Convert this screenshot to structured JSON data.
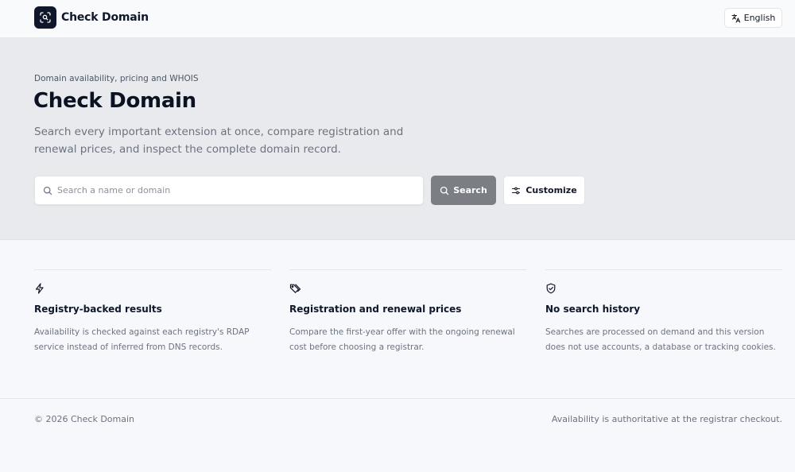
{
  "header": {
    "app_name": "Check Domain",
    "language_label": "English",
    "logo_icon": "magnify-scan-icon",
    "language_icon": "translate-icon"
  },
  "hero": {
    "eyebrow": "Domain availability, pricing and WHOIS",
    "title": "Check Domain",
    "description": "Search every important extension at once, compare registration and renewal prices, and inspect the complete domain record.",
    "search_placeholder": "Search a name or domain",
    "search_value": "",
    "search_button_label": "Search",
    "customize_button_label": "Customize",
    "search_button_color": "#7c7e86"
  },
  "features": [
    {
      "icon": "lightning-icon",
      "title": "Registry-backed results",
      "description": "Availability is checked against each registry's RDAP service instead of inferred from DNS records."
    },
    {
      "icon": "price-tags-icon",
      "title": "Registration and renewal prices",
      "description": "Compare the first-year offer with the ongoing renewal cost before choosing a registrar."
    },
    {
      "icon": "shield-check-icon",
      "title": "No search history",
      "description": "Searches are processed on demand and this version does not use accounts, a database or tracking cookies."
    }
  ],
  "footer": {
    "copyright": "© 2026 Check Domain",
    "note": "Availability is authoritative at the registrar checkout."
  }
}
